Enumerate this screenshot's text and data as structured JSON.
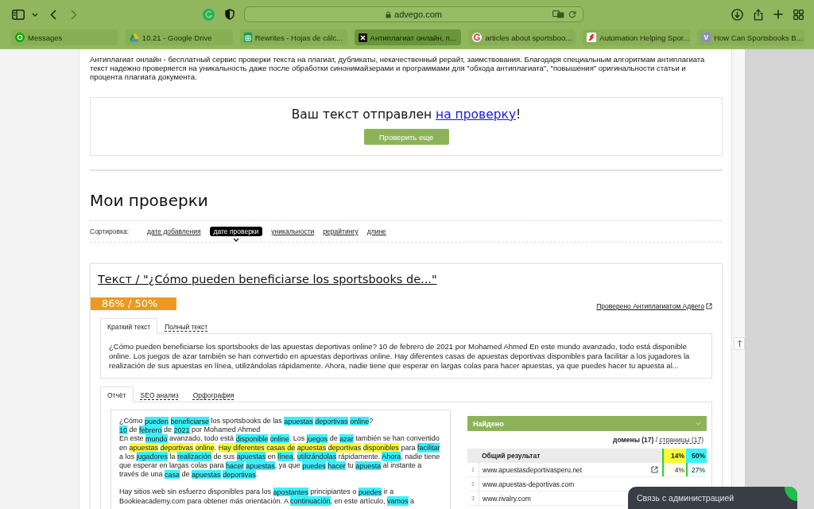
{
  "browser": {
    "url": "advego.com",
    "back": {
      "disabled": false
    },
    "forward": {
      "disabled": true
    },
    "tabs": [
      {
        "title": "Messages",
        "selected": false
      },
      {
        "title": "10.21 - Google Drive",
        "selected": false
      },
      {
        "title": "Rewrites - Hojas de cálc...",
        "selected": false
      },
      {
        "title": "Антиплагиат онлайн, п...",
        "selected": true
      },
      {
        "title": "articles about sportsboo...",
        "selected": false
      },
      {
        "title": "Automation Helping Spor...",
        "selected": false
      },
      {
        "title": "How Can Sportsbooks B...",
        "selected": false,
        "favicon_letter": "V"
      }
    ]
  },
  "intro": "Антиплагиат онлайн - бесплатный сервис проверки текста на плагиат, дубликаты, некачественный рерайт, заимствования. Благодаря специальным алгоритмам антиплагиата текст надежно проверяется на уникальность даже после обработки синонимайзерами и программами для \"обхода антиплагиата\", \"повышения\" оригинальности статьи и процента плагиата документа.",
  "notice": {
    "text": "Ваш текст отправлен",
    "link": "на проверку",
    "end": "!",
    "button": "Проверить еще"
  },
  "checks": {
    "title": "Мои проверки",
    "sort": {
      "label": "Сортировка:",
      "options": [
        {
          "label": "дате добавления",
          "selected": false
        },
        {
          "label": "дате проверки",
          "selected": true
        },
        {
          "label": "уникальности",
          "selected": false
        },
        {
          "label": "рерайтингу",
          "selected": false
        },
        {
          "label": "длине",
          "selected": false
        }
      ]
    }
  },
  "result": {
    "title": "Текст / \"¿Cómo pueden beneficiarse los sportsbooks de...\"",
    "score": "86% / 50%",
    "verified": "Проверено Антиплагиатом Адвего",
    "text_tabs": [
      {
        "label": "Краткий текст",
        "selected": true
      },
      {
        "label": "Полный текст",
        "selected": false
      }
    ],
    "excerpt": "¿Cómo pueden beneficiarse los sportsbooks de las apuestas deportivas online? 10 de febrero de 2021 por Mohamed Ahmed En este mundo avanzado, todo está disponible online. Los juegos de azar también se han convertido en apuestas deportivas online. Hay diferentes casas de apuestas deportivas disponibles para facilitar a los jugadores la realización de sus apuestas en línea, utilizándolas rápidamente. Ahora, nadie tiene que esperar en largas colas para hacer apuestas, ya que puedes hacer tu apuesta al...",
    "report_tabs": [
      {
        "label": "Отчёт",
        "selected": true
      },
      {
        "label": "SEO анализ",
        "selected": false
      },
      {
        "label": "Орфография",
        "selected": false
      }
    ],
    "report": {
      "paragraphs": [
        {
          "lines": [
            [
              {
                "text": "¿Cómo "
              },
              {
                "text": "pueden",
                "color": "#3cf0fa"
              },
              {
                "text": "beneficiarse",
                "color": "#3cf0fa"
              },
              {
                "text": " los sportsbooks de las "
              },
              {
                "text": "apuestas",
                "color": "#3cf0fa"
              },
              {
                "text": "deportivas",
                "color": "#3cf0fa"
              },
              {
                "text": "online",
                "color": "#3cf0fa"
              },
              {
                "text": "?"
              }
            ],
            [
              {
                "text": "10",
                "color": "#3cf0fa"
              },
              {
                "text": " de "
              },
              {
                "text": "febrero",
                "color": "#3cf0fa"
              },
              {
                "text": " de "
              },
              {
                "text": "2021",
                "color": "#3cf0fa"
              },
              {
                "text": " por Mohamed Ahmed"
              }
            ],
            [
              {
                "text": "En este "
              },
              {
                "text": "mundo",
                "color": "#3cf0fa"
              },
              {
                "text": " avanzado, todo está "
              },
              {
                "text": "disponible",
                "color": "#3cf0fa"
              },
              {
                "text": "online",
                "color": "#3cf0fa"
              },
              {
                "text": ". Los "
              },
              {
                "text": "juegos",
                "color": "#3cf0fa"
              },
              {
                "text": " de "
              },
              {
                "text": "azar",
                "color": "#3cf0fa"
              },
              {
                "text": " también se han convertido en "
              },
              {
                "text": "apuestas",
                "color": "#fbfb3c"
              },
              {
                "text": "deportivas",
                "color": "#fbfb3c"
              },
              {
                "text": "online",
                "color": "#fbfb3c"
              },
              {
                "text": ". "
              },
              {
                "text": "Hay diferentes",
                "color": "#fbfb3c"
              },
              {
                "text": "casas de",
                "color": "#fbfb3c"
              },
              {
                "text": "apuestas",
                "color": "#fbfb3c"
              },
              {
                "text": "deportivas",
                "color": "#fbfb3c"
              },
              {
                "text": "disponibles",
                "color": "#fbfb3c"
              },
              {
                "text": " para "
              },
              {
                "text": "facilitar",
                "color": "#3cf0fa"
              },
              {
                "text": " a los "
              },
              {
                "text": "jugadores",
                "color": "#3cf0fa"
              },
              {
                "text": " la "
              },
              {
                "text": "realización",
                "color": "#3cf0fa"
              },
              {
                "text": " de sus "
              },
              {
                "text": "apuestas",
                "color": "#3cf0fa"
              },
              {
                "text": " en "
              },
              {
                "text": "línea",
                "color": "#3cf0fa"
              },
              {
                "text": ", "
              },
              {
                "text": "utilizándolas",
                "color": "#3cf0fa"
              },
              {
                "text": " rápidamente. "
              },
              {
                "text": "Ahora",
                "color": "#3cf0fa"
              },
              {
                "text": ", nadie tiene que esperar en largas colas para "
              },
              {
                "text": "hacer",
                "color": "#3cf0fa"
              },
              {
                "text": "apuestas",
                "color": "#3cf0fa"
              },
              {
                "text": ", ya que "
              },
              {
                "text": "puedes",
                "color": "#3cf0fa"
              },
              {
                "text": "hacer",
                "color": "#3cf0fa"
              },
              {
                "text": " tu "
              },
              {
                "text": "apuesta",
                "color": "#3cf0fa"
              },
              {
                "text": " al instante a través de una "
              },
              {
                "text": "casa",
                "color": "#3cf0fa"
              },
              {
                "text": " de "
              },
              {
                "text": "apuestas",
                "color": "#3cf0fa"
              },
              {
                "text": "deportivas",
                "color": "#3cf0fa"
              },
              {
                "text": "."
              }
            ]
          ]
        },
        {
          "lines": [
            [
              {
                "text": "Hay sitios web sin esfuerzo disponibles para los "
              },
              {
                "text": "apostantes",
                "color": "#3cf0fa"
              },
              {
                "text": " principiantes o "
              },
              {
                "text": "puedes",
                "color": "#3cf0fa"
              },
              {
                "text": " ir a Bookieacademy.com para obtener más orientación. A "
              },
              {
                "text": "continuación",
                "color": "#3cf0fa"
              },
              {
                "text": ", en este artículo, "
              },
              {
                "text": "vamos",
                "color": "#3cf0fa"
              },
              {
                "text": " a"
              }
            ]
          ]
        }
      ]
    },
    "found": {
      "title": "Найдено",
      "domains": "домены (17)",
      "separator": "/",
      "pages": "страницы (17)",
      "total": {
        "label": "Общий результат",
        "values": [
          "14%",
          "50%"
        ]
      },
      "rows": [
        {
          "index": "1",
          "domain": "www.apuestasdeportivasperu.net",
          "values": [
            "4%",
            "27%"
          ]
        },
        {
          "index": "2",
          "domain": "www.apuestas-deportivas.com"
        },
        {
          "index": "3",
          "domain": "www.rivalry.com"
        }
      ]
    }
  },
  "chat": {
    "label": "Связь с администрацией"
  }
}
